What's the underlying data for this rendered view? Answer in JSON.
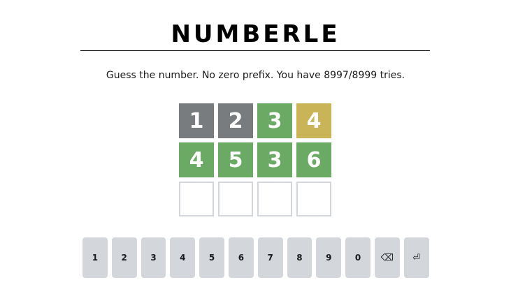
{
  "title": "NUMBERLE",
  "instructions": "Guess the number. No zero prefix. You have 8997/8999 tries.",
  "colors": {
    "absent": "#787c7e",
    "correct": "#6aaa64",
    "present": "#c9b458",
    "empty_border": "#d3d6da",
    "key_bg": "#d3d6da"
  },
  "board": {
    "rows": [
      {
        "tiles": [
          {
            "value": "1",
            "state": "absent"
          },
          {
            "value": "2",
            "state": "absent"
          },
          {
            "value": "3",
            "state": "correct"
          },
          {
            "value": "4",
            "state": "present"
          }
        ]
      },
      {
        "tiles": [
          {
            "value": "4",
            "state": "correct"
          },
          {
            "value": "5",
            "state": "correct"
          },
          {
            "value": "3",
            "state": "correct"
          },
          {
            "value": "6",
            "state": "correct"
          }
        ]
      },
      {
        "tiles": [
          {
            "value": "",
            "state": "empty"
          },
          {
            "value": "",
            "state": "empty"
          },
          {
            "value": "",
            "state": "empty"
          },
          {
            "value": "",
            "state": "empty"
          }
        ]
      }
    ]
  },
  "keyboard": {
    "keys": [
      {
        "label": "1",
        "name": "key-1"
      },
      {
        "label": "2",
        "name": "key-2"
      },
      {
        "label": "3",
        "name": "key-3"
      },
      {
        "label": "4",
        "name": "key-4"
      },
      {
        "label": "5",
        "name": "key-5"
      },
      {
        "label": "6",
        "name": "key-6"
      },
      {
        "label": "7",
        "name": "key-7"
      },
      {
        "label": "8",
        "name": "key-8"
      },
      {
        "label": "9",
        "name": "key-9"
      },
      {
        "label": "0",
        "name": "key-0"
      },
      {
        "label": "⌫",
        "name": "backspace-key",
        "icon": "backspace-icon"
      },
      {
        "label": "⏎",
        "name": "enter-key",
        "icon": "enter-icon"
      }
    ]
  }
}
